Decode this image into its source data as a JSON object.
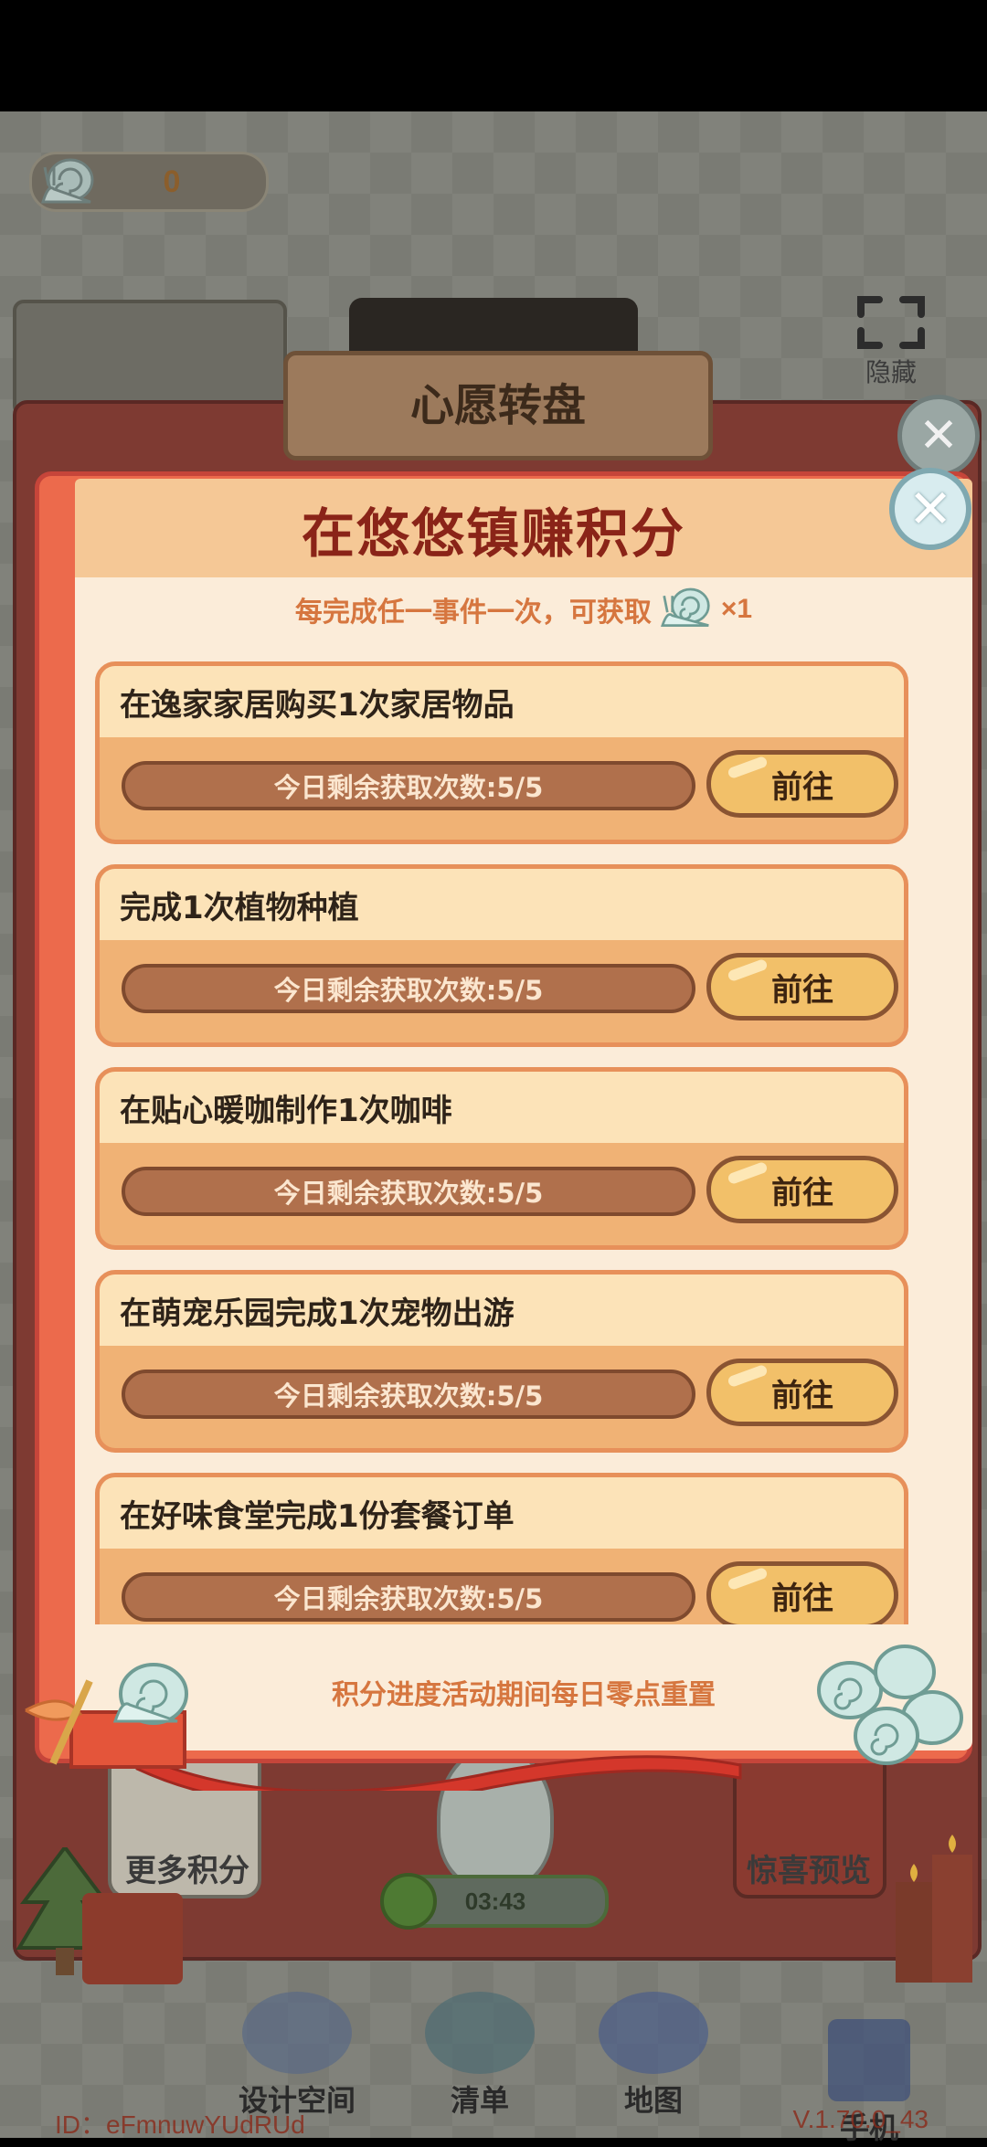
{
  "hud": {
    "currency_value": "0",
    "hide_label": "隐藏"
  },
  "background_panel": {
    "title": "心愿转盘",
    "more_points_label": "更多积分",
    "surprise_preview_label": "惊喜预览",
    "timer": "03:43"
  },
  "dialog": {
    "title": "在悠悠镇赚积分",
    "subtitle_prefix": "每完成任一事件一次，可获取",
    "subtitle_multiplier": "×1",
    "footer_note": "积分进度活动期间每日零点重置",
    "tasks": [
      {
        "name": "在逸家家居购买1次家居物品",
        "remaining": "今日剩余获取次数:5/5",
        "go_label": "前往"
      },
      {
        "name": "完成1次植物种植",
        "remaining": "今日剩余获取次数:5/5",
        "go_label": "前往"
      },
      {
        "name": "在贴心暖咖制作1次咖啡",
        "remaining": "今日剩余获取次数:5/5",
        "go_label": "前往"
      },
      {
        "name": "在萌宠乐园完成1次宠物出游",
        "remaining": "今日剩余获取次数:5/5",
        "go_label": "前往"
      },
      {
        "name": "在好味食堂完成1份套餐订单",
        "remaining": "今日剩余获取次数:5/5",
        "go_label": "前往"
      }
    ]
  },
  "navbar": {
    "items": [
      {
        "label": "设计空间",
        "icon": "ruler-icon"
      },
      {
        "label": "清单",
        "icon": "checklist-icon"
      },
      {
        "label": "地图",
        "icon": "map-pin-icon"
      },
      {
        "label": "手机",
        "icon": "phone-icon"
      }
    ],
    "id_text": "ID：eFmnuwYUdRUd",
    "version_text": "V.1.70.0_43"
  },
  "colors": {
    "dialog_border": "#ec6a4c",
    "dialog_header": "#f5c896",
    "dialog_title": "#8a2418",
    "task_card": "#f0b275",
    "go_button": "#f2c069",
    "progress_bar": "#b0704c"
  }
}
